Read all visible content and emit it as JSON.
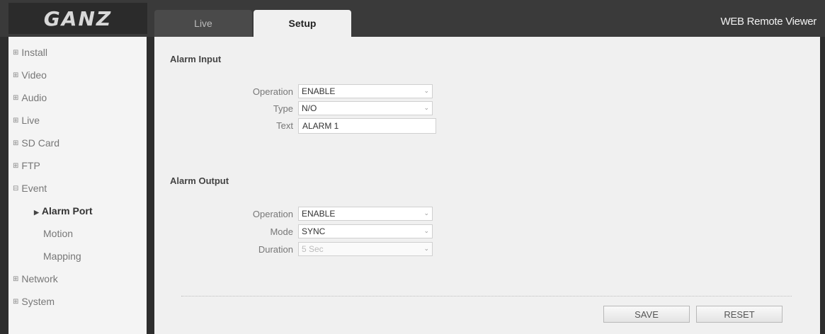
{
  "header": {
    "logo_text": "GANZ",
    "tabs": [
      {
        "label": "Live"
      },
      {
        "label": "Setup"
      }
    ],
    "app_title": "WEB Remote Viewer"
  },
  "sidebar": {
    "items": [
      {
        "label": "Install"
      },
      {
        "label": "Video"
      },
      {
        "label": "Audio"
      },
      {
        "label": "Live"
      },
      {
        "label": "SD Card"
      },
      {
        "label": "FTP"
      },
      {
        "label": "Event"
      },
      {
        "label": "Network"
      },
      {
        "label": "System"
      }
    ],
    "event_sub": [
      {
        "label": "Alarm Port"
      },
      {
        "label": "Motion"
      },
      {
        "label": "Mapping"
      }
    ]
  },
  "alarm_input": {
    "title": "Alarm Input",
    "operation_label": "Operation",
    "operation_value": "ENABLE",
    "type_label": "Type",
    "type_value": "N/O",
    "text_label": "Text",
    "text_value": "ALARM 1"
  },
  "alarm_output": {
    "title": "Alarm Output",
    "operation_label": "Operation",
    "operation_value": "ENABLE",
    "mode_label": "Mode",
    "mode_value": "SYNC",
    "duration_label": "Duration",
    "duration_value": "5 Sec"
  },
  "buttons": {
    "save": "SAVE",
    "reset": "RESET"
  }
}
